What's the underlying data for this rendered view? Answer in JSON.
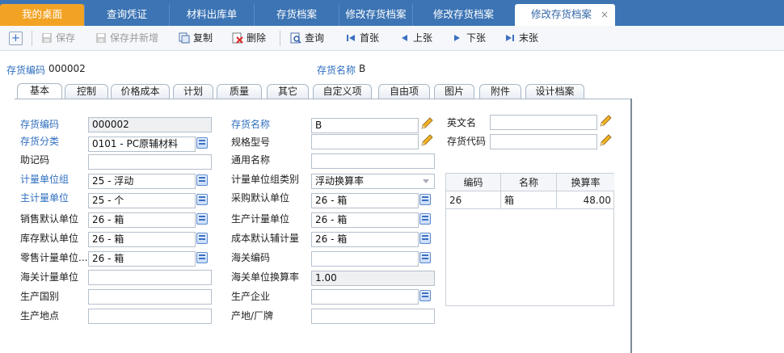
{
  "tabs": {
    "home": "我的桌面",
    "t1": "查询凭证",
    "t2": "材料出库单",
    "t3": "存货档案",
    "t4": "修改存货档案",
    "t5": "修改存货档案",
    "active": "修改存货档案",
    "close": "×"
  },
  "toolbar": {
    "add": "+",
    "save": "保存",
    "save_new": "保存并新增",
    "copy": "复制",
    "delete": "删除",
    "query": "查询",
    "first": "首张",
    "prev": "上张",
    "next": "下张",
    "last": "末张"
  },
  "header": {
    "code_label": "存货编码",
    "code_value": "000002",
    "name_label": "存货名称",
    "name_value": "B"
  },
  "subtabs": [
    "基本",
    "控制",
    "价格成本",
    "计划",
    "质量",
    "其它",
    "自定义项",
    "自由项",
    "图片",
    "附件",
    "设计档案"
  ],
  "form": {
    "inv_code_label": "存货编码",
    "inv_code": "000002",
    "inv_class_label": "存货分类",
    "inv_class": "0101 - PC原辅材料",
    "mnemonic_label": "助记码",
    "mnemonic": "",
    "unit_group_label": "计量单位组",
    "unit_group": "25 - 浮动",
    "main_unit_label": "主计量单位",
    "main_unit": "25 - 个",
    "sales_unit_label": "销售默认单位",
    "sales_unit": "26 - 箱",
    "stock_unit_label": "库存默认单位",
    "stock_unit": "26 - 箱",
    "retail_unit_label": "零售计量单位...",
    "retail_unit": "26 - 箱",
    "customs_unit_label": "海关计量单位",
    "customs_unit": "",
    "origin_country_label": "生产国别",
    "origin_country": "",
    "origin_place_label": "生产地点",
    "origin_place": "",
    "inv_name_label": "存货名称",
    "inv_name": "B",
    "spec_label": "规格型号",
    "spec": "",
    "common_name_label": "通用名称",
    "common_name": "",
    "unit_group_type_label": "计量单位组类别",
    "unit_group_type": "浮动换算率",
    "purchase_unit_label": "采购默认单位",
    "purchase_unit": "26 - 箱",
    "prod_unit_label": "生产计量单位",
    "prod_unit": "26 - 箱",
    "cost_unit_label": "成本默认辅计量",
    "cost_unit": "26 - 箱",
    "customs_code_label": "海关编码",
    "customs_code": "",
    "customs_rate_label": "海关单位换算率",
    "customs_rate": "1.00",
    "manufacturer_label": "生产企业",
    "manufacturer": "",
    "brand_label": "产地/厂牌",
    "brand": "",
    "en_name_label": "英文名",
    "en_name": "",
    "inv_code2_label": "存货代码",
    "inv_code2": ""
  },
  "grid": {
    "headers": [
      "编码",
      "名称",
      "换算率"
    ],
    "rows": [
      [
        "26",
        "箱",
        "48.00"
      ]
    ]
  },
  "colors": {
    "tabbar": "#3c74b4",
    "home_tab": "#f3a323",
    "required_label": "#2f6fc0"
  }
}
